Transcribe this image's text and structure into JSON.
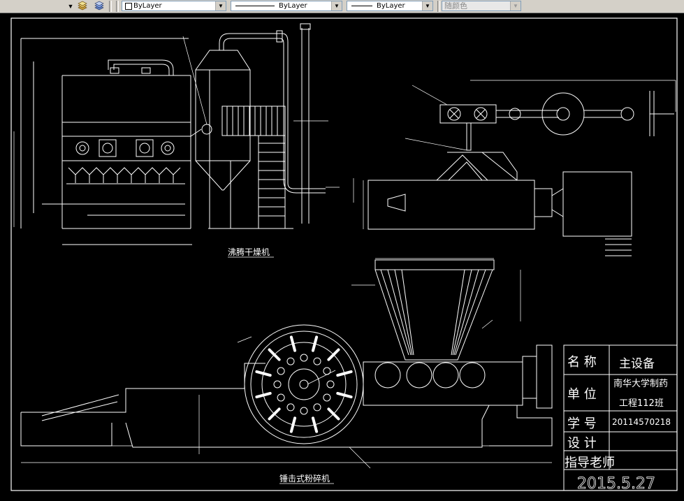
{
  "toolbar": {
    "layer_combo_1": "ByLayer",
    "linetype_combo": "ByLayer",
    "lineweight_combo": "ByLayer",
    "color_combo": "随颜色",
    "icons": [
      "layer-states-icon",
      "layer-previous-icon"
    ]
  },
  "drawing": {
    "title_dryer": "沸腾干燥机",
    "title_crusher": "锤击式粉碎机",
    "titleblock": {
      "name_label": "名  称",
      "name_value": "主设备",
      "unit_label": "单  位",
      "unit_value_1": "南华大学制药",
      "unit_value_2": "工程112班",
      "id_label": "学  号",
      "id_value": "20114570218",
      "design_label": "设  计",
      "teacher_label": "指导老师",
      "date": "2015.5.27"
    }
  },
  "colors": {
    "background": "#000000",
    "line": "#ffffff",
    "toolbar": "#d4d0c8"
  }
}
